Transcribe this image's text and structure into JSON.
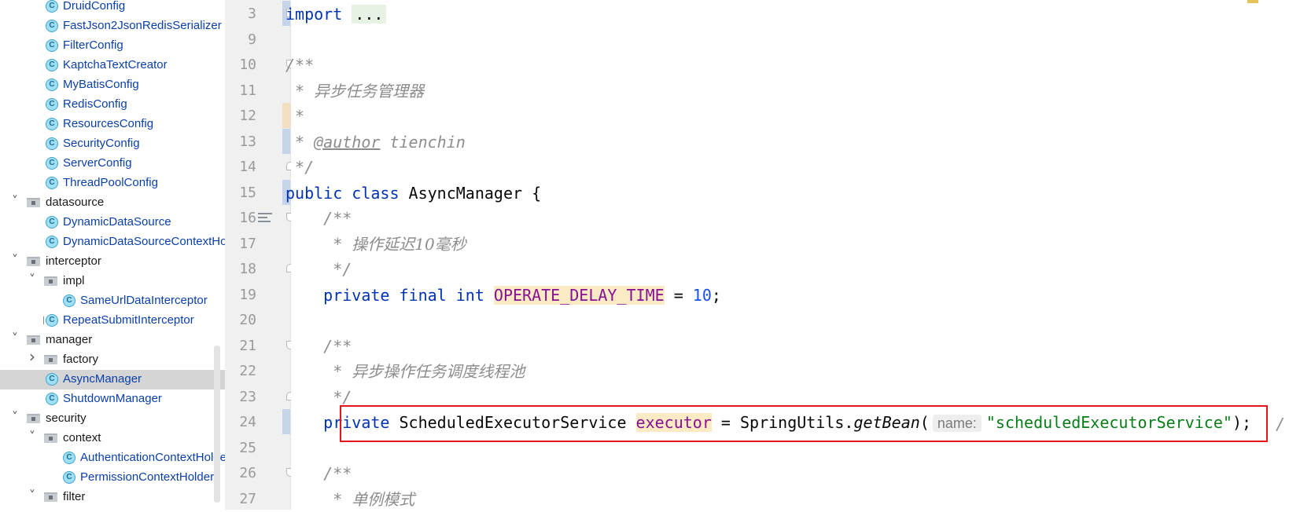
{
  "project_tree": {
    "items": [
      {
        "label": "DruidConfig",
        "kind": "class",
        "indent": 2,
        "expander": "none"
      },
      {
        "label": "FastJson2JsonRedisSerializer",
        "kind": "class",
        "indent": 2,
        "expander": "none"
      },
      {
        "label": "FilterConfig",
        "kind": "class",
        "indent": 2,
        "expander": "none"
      },
      {
        "label": "KaptchaTextCreator",
        "kind": "class",
        "indent": 2,
        "expander": "none"
      },
      {
        "label": "MyBatisConfig",
        "kind": "class",
        "indent": 2,
        "expander": "none"
      },
      {
        "label": "RedisConfig",
        "kind": "class",
        "indent": 2,
        "expander": "none"
      },
      {
        "label": "ResourcesConfig",
        "kind": "class",
        "indent": 2,
        "expander": "none"
      },
      {
        "label": "SecurityConfig",
        "kind": "class",
        "indent": 2,
        "expander": "none"
      },
      {
        "label": "ServerConfig",
        "kind": "class",
        "indent": 2,
        "expander": "none"
      },
      {
        "label": "ThreadPoolConfig",
        "kind": "class",
        "indent": 2,
        "expander": "none"
      },
      {
        "label": "datasource",
        "kind": "package",
        "indent": 1,
        "expander": "expanded"
      },
      {
        "label": "DynamicDataSource",
        "kind": "class",
        "indent": 2,
        "expander": "none"
      },
      {
        "label": "DynamicDataSourceContextHolder",
        "kind": "class",
        "indent": 2,
        "expander": "none"
      },
      {
        "label": "interceptor",
        "kind": "package",
        "indent": 1,
        "expander": "expanded"
      },
      {
        "label": "impl",
        "kind": "package",
        "indent": 2,
        "expander": "expanded"
      },
      {
        "label": "SameUrlDataInterceptor",
        "kind": "class",
        "indent": 3,
        "expander": "none"
      },
      {
        "label": "RepeatSubmitInterceptor",
        "kind": "class-abstract",
        "indent": 2,
        "expander": "none"
      },
      {
        "label": "manager",
        "kind": "package",
        "indent": 1,
        "expander": "expanded"
      },
      {
        "label": "factory",
        "kind": "package",
        "indent": 2,
        "expander": "collapsed"
      },
      {
        "label": "AsyncManager",
        "kind": "class",
        "indent": 2,
        "expander": "none",
        "selected": true
      },
      {
        "label": "ShutdownManager",
        "kind": "class",
        "indent": 2,
        "expander": "none"
      },
      {
        "label": "security",
        "kind": "package",
        "indent": 1,
        "expander": "expanded"
      },
      {
        "label": "context",
        "kind": "package",
        "indent": 2,
        "expander": "expanded"
      },
      {
        "label": "AuthenticationContextHolder",
        "kind": "class",
        "indent": 3,
        "expander": "none"
      },
      {
        "label": "PermissionContextHolder",
        "kind": "class",
        "indent": 3,
        "expander": "none"
      },
      {
        "label": "filter",
        "kind": "package",
        "indent": 2,
        "expander": "expanded"
      }
    ]
  },
  "editor": {
    "lines": [
      {
        "num": "3",
        "fold": "plus",
        "vcs": "blue",
        "tokens": [
          [
            "kw",
            "import"
          ],
          [
            "plain",
            " "
          ],
          [
            "folded",
            "..."
          ]
        ]
      },
      {
        "num": "9",
        "fold": "",
        "vcs": "",
        "tokens": []
      },
      {
        "num": "10",
        "fold": "start",
        "vcs": "",
        "tokens": [
          [
            "cmt",
            "/**"
          ]
        ]
      },
      {
        "num": "11",
        "fold": "",
        "vcs": "",
        "tokens": [
          [
            "cmt",
            " * "
          ],
          [
            "cmt-cn",
            "异步任务管理器"
          ]
        ]
      },
      {
        "num": "12",
        "fold": "",
        "vcs": "orange",
        "tokens": [
          [
            "cmt",
            " *"
          ]
        ]
      },
      {
        "num": "13",
        "fold": "",
        "vcs": "blue",
        "tokens": [
          [
            "cmt",
            " * "
          ],
          [
            "tag",
            "@author"
          ],
          [
            "cmt",
            " tienchin"
          ]
        ]
      },
      {
        "num": "14",
        "fold": "end",
        "vcs": "",
        "tokens": [
          [
            "cmt",
            " */"
          ]
        ]
      },
      {
        "num": "15",
        "fold": "",
        "vcs": "blue",
        "tokens": [
          [
            "kw",
            "public class "
          ],
          [
            "plain",
            "AsyncManager {"
          ]
        ]
      },
      {
        "num": "16",
        "fold": "start",
        "vcs": "",
        "doc": true,
        "tokens": [
          [
            "plain",
            "    "
          ],
          [
            "cmt",
            "/**"
          ]
        ]
      },
      {
        "num": "17",
        "fold": "",
        "vcs": "",
        "tokens": [
          [
            "plain",
            "    "
          ],
          [
            "cmt",
            " * "
          ],
          [
            "cmt-cn",
            "操作延迟10毫秒"
          ]
        ]
      },
      {
        "num": "18",
        "fold": "end",
        "vcs": "",
        "tokens": [
          [
            "plain",
            "    "
          ],
          [
            "cmt",
            " */"
          ]
        ]
      },
      {
        "num": "19",
        "fold": "",
        "vcs": "",
        "tokens": [
          [
            "plain",
            "    "
          ],
          [
            "kw",
            "private final int "
          ],
          [
            "const",
            "OPERATE_DELAY_TIME"
          ],
          [
            "plain",
            " = "
          ],
          [
            "num",
            "10"
          ],
          [
            "plain",
            ";"
          ]
        ]
      },
      {
        "num": "20",
        "fold": "",
        "vcs": "",
        "tokens": []
      },
      {
        "num": "21",
        "fold": "start",
        "vcs": "",
        "tokens": [
          [
            "plain",
            "    "
          ],
          [
            "cmt",
            "/**"
          ]
        ]
      },
      {
        "num": "22",
        "fold": "",
        "vcs": "",
        "tokens": [
          [
            "plain",
            "    "
          ],
          [
            "cmt",
            " * "
          ],
          [
            "cmt-cn",
            "异步操作任务调度线程池"
          ]
        ]
      },
      {
        "num": "23",
        "fold": "end",
        "vcs": "",
        "tokens": [
          [
            "plain",
            "    "
          ],
          [
            "cmt",
            " */"
          ]
        ]
      },
      {
        "num": "24",
        "fold": "",
        "vcs": "blue",
        "tokens": [
          [
            "plain",
            "    "
          ],
          [
            "kw",
            "private "
          ],
          [
            "plain",
            "ScheduledExecutorService "
          ],
          [
            "fld",
            "executor"
          ],
          [
            "plain",
            " = SpringUtils."
          ],
          [
            "method",
            "getBean"
          ],
          [
            "plain",
            "("
          ],
          [
            "hint",
            "name:"
          ],
          [
            "str",
            "\"scheduledExecutorService\""
          ],
          [
            "plain",
            ");"
          ]
        ]
      },
      {
        "num": "25",
        "fold": "",
        "vcs": "",
        "tokens": []
      },
      {
        "num": "26",
        "fold": "start",
        "vcs": "",
        "tokens": [
          [
            "plain",
            "    "
          ],
          [
            "cmt",
            "/**"
          ]
        ]
      },
      {
        "num": "27",
        "fold": "",
        "vcs": "",
        "tokens": [
          [
            "plain",
            "    "
          ],
          [
            "cmt",
            " * "
          ],
          [
            "cmt-cn",
            "单例模式"
          ]
        ]
      }
    ],
    "trailing_glyph": "/"
  },
  "colors": {
    "keyword": "#0033b3",
    "comment": "#8c8c8c",
    "string": "#067d17",
    "number": "#1750eb",
    "field": "#871094",
    "highlight_border": "#e8141c",
    "selection": "#d5d5d5"
  }
}
